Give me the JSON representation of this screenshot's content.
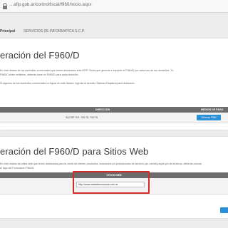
{
  "browser": {
    "url": "...afip.gob.ar/controlfiscal/f960/Inicio.aspx"
  },
  "user_bar": {
    "label": "Principal",
    "value": "SERVICIOS DE INFORMATICA S.C.P."
  },
  "section1": {
    "title": "eración del F960/D",
    "paragraph_1a": "En este listado de los domicilios comerciales que tenés declarados ante AFIP. Tenés que generar e imprimir el F960/D por cada uno de los domicilios. Tu",
    "paragraph_1b": "F960/D debe exhibirse, deberás sacer el F960/D para cada domicilio.",
    "paragraph_1c": "Si algunos de los domicilios comerciales no figura en este listado, ingresá al servicio Sistema Registral para declararlo.",
    "table": {
      "col_address": "DIRECCIÓN",
      "col_actions": "MEDIOS DE PAGO",
      "rows": [
        {
          "address": "SUCRE 501, SALTA, SALTA",
          "action": "Generar F960"
        }
      ]
    }
  },
  "section2": {
    "title": "eración del F960/D para Sitios Web",
    "paragraph_2a": "En este listado los sitios web que tenés declarados para la venta de bienes, productos, locaciones y/o prestaciones de servicio por cuenta propia y/o de terceros, deberás colocar",
    "paragraph_2b": "el logo del Formulario F960/D.",
    "table": {
      "col_site": "SITIOS WEB",
      "site_value": "http://www.cadadimensions.com.ar"
    }
  },
  "colors": {
    "accent": "#2d8fd8",
    "header": "#6c6c6c",
    "highlight": "#d32b2b"
  }
}
